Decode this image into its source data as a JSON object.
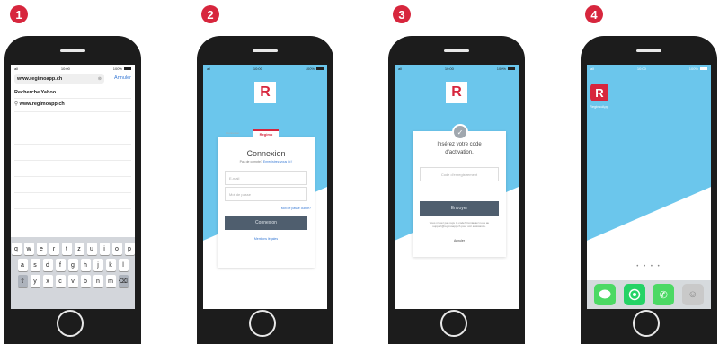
{
  "steps": [
    "1",
    "2",
    "3",
    "4"
  ],
  "status": {
    "time": "10:00",
    "battery": "100%",
    "signal": "all"
  },
  "screen1": {
    "url_value": "www.regimoapp.ch",
    "cancel_label": "Annuler",
    "suggest_header": "Recherche Yahoo",
    "suggest_item": "www.regimoapp.ch",
    "keyboard_rows": [
      [
        "q",
        "w",
        "e",
        "r",
        "t",
        "z",
        "u",
        "i",
        "o",
        "p"
      ],
      [
        "a",
        "s",
        "d",
        "f",
        "g",
        "h",
        "j",
        "k",
        "l"
      ],
      [
        "y",
        "x",
        "c",
        "v",
        "b",
        "n",
        "m"
      ]
    ]
  },
  "screen2": {
    "logo_letter": "R",
    "tab_label": "Regimo",
    "tab_other": "Connexion",
    "title": "Connexion",
    "subtitle_prefix": "Pas de compte?",
    "subtitle_link": "Enregistrez-vous ici !",
    "email_placeholder": "E-mail",
    "password_placeholder": "Mot de passe",
    "forgot_link": "Mot de passe oublié?",
    "submit_label": "Connexion",
    "legal_link": "Mentions légales"
  },
  "screen3": {
    "logo_letter": "R",
    "title_line1": "Insérez votre code",
    "title_line2": "d'activation.",
    "code_placeholder": "Code d'enregistrement",
    "submit_label": "Envoyer",
    "help_text": "Vous n'avez pas reçu le code? Contactez nous au support@regimoapp.ch pour voir assistance.",
    "cancel_label": "Annuler"
  },
  "screen4": {
    "app_letter": "R",
    "app_label": "RegimoApp",
    "page_dots": "• • • •"
  },
  "colors": {
    "brand": "#d7263d",
    "sky": "#6bc6ec",
    "button": "#4f5e6e",
    "link": "#3a7bd5"
  }
}
